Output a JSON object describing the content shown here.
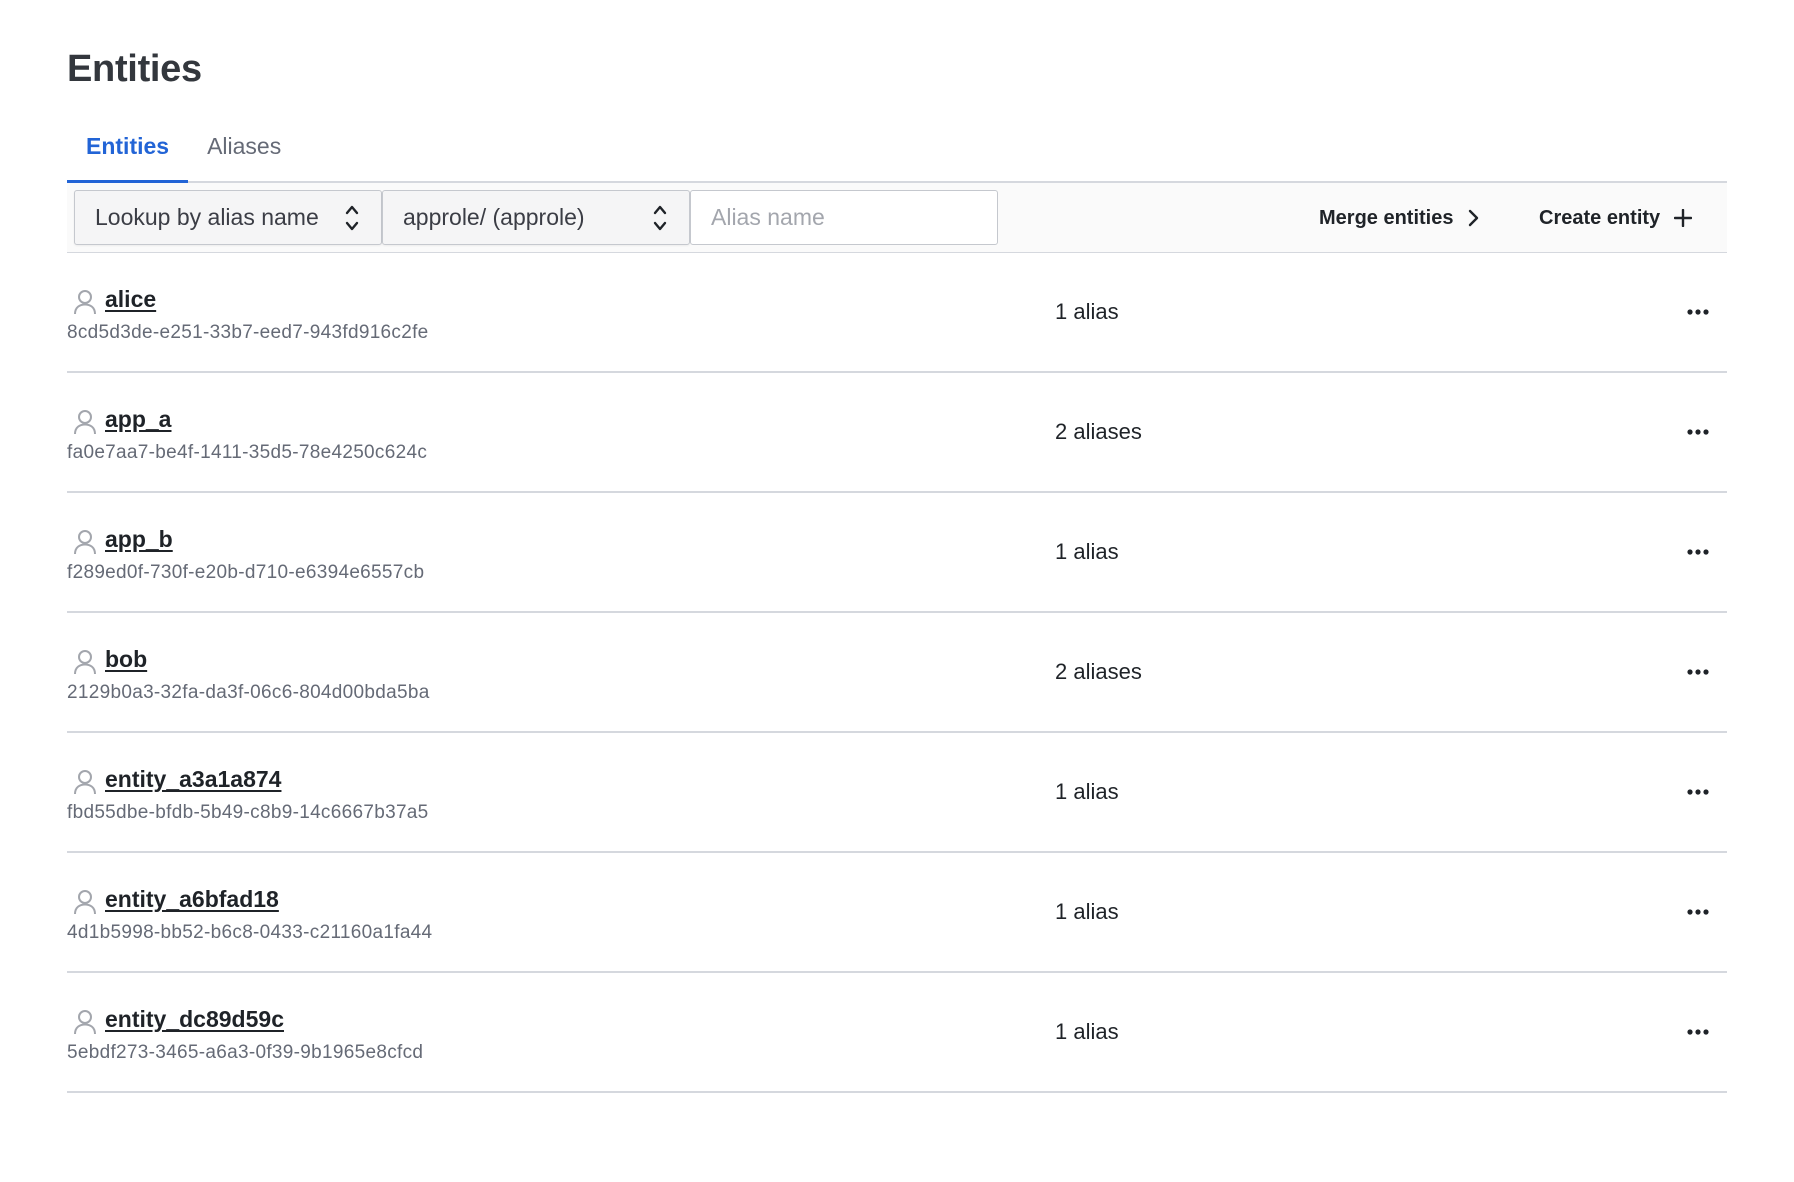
{
  "page": {
    "title": "Entities"
  },
  "tabs": [
    {
      "label": "Entities",
      "active": true
    },
    {
      "label": "Aliases",
      "active": false
    }
  ],
  "toolbar": {
    "lookup_select": {
      "value": "Lookup by alias name"
    },
    "mount_select": {
      "value": "approle/ (approle)"
    },
    "alias_input": {
      "value": "",
      "placeholder": "Alias name"
    },
    "merge_label": "Merge entities",
    "create_label": "Create entity"
  },
  "entities": [
    {
      "name": "alice",
      "id": "8cd5d3de-e251-33b7-eed7-943fd916c2fe",
      "aliases": "1 alias"
    },
    {
      "name": "app_a",
      "id": "fa0e7aa7-be4f-1411-35d5-78e4250c624c",
      "aliases": "2 aliases"
    },
    {
      "name": "app_b",
      "id": "f289ed0f-730f-e20b-d710-e6394e6557cb",
      "aliases": "1 alias"
    },
    {
      "name": "bob",
      "id": "2129b0a3-32fa-da3f-06c6-804d00bda5ba",
      "aliases": "2 aliases"
    },
    {
      "name": "entity_a3a1a874",
      "id": "fbd55dbe-bfdb-5b49-c8b9-14c6667b37a5",
      "aliases": "1 alias"
    },
    {
      "name": "entity_a6bfad18",
      "id": "4d1b5998-bb52-b6c8-0433-c21160a1fa44",
      "aliases": "1 alias"
    },
    {
      "name": "entity_dc89d59c",
      "id": "5ebdf273-3465-a6a3-0f39-9b1965e8cfcd",
      "aliases": "1 alias"
    }
  ],
  "icons": {
    "entity": "user-icon",
    "row_menu": "more-horizontal-icon",
    "select_toggle": "chevron-up-down-icon",
    "merge": "chevron-right-icon",
    "create": "plus-icon"
  },
  "colors": {
    "accent": "#2264d6",
    "muted_text": "#656a76",
    "border": "#d5d8de"
  }
}
